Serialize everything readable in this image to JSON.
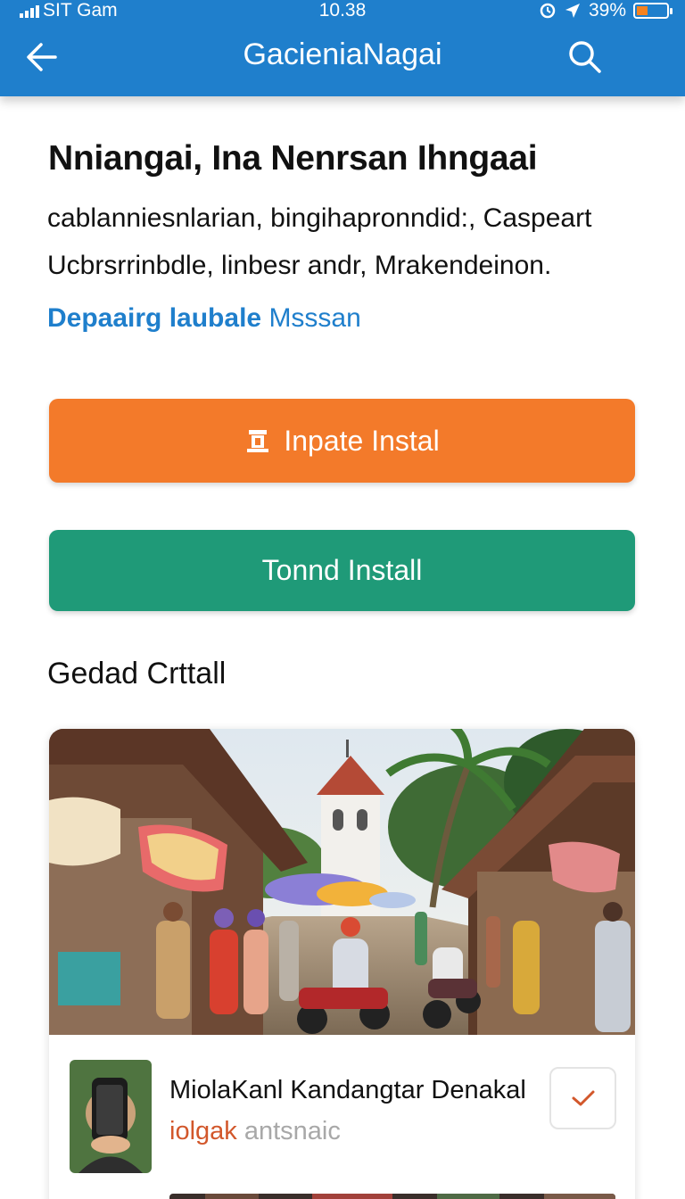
{
  "status_bar": {
    "carrier": "SIT Gam",
    "time": "10.38",
    "battery_percent": "39%",
    "battery_level": 0.39
  },
  "header": {
    "title": "GacieniaNagai",
    "back_icon": "back-arrow-icon",
    "search_icon": "search-icon"
  },
  "content": {
    "headline": "Nniangai, Ina Nenrsan Ihngaai",
    "description_line1": "cablanniesnlarian, bingihapronndid:, Caspeart",
    "description_line2": "Ucbrsrrinbdle, linbesr andr, Mrakendeinon.",
    "link_strong": "Depaairg laubale",
    "link_rest": "Msssan",
    "primary_button": "Inpate Instal",
    "secondary_button": "Tonnd Install",
    "section_title": "Gedad Crttall"
  },
  "card": {
    "item_title": "MiolaKanl Kandangtar Denakal",
    "item_sub_accent": "iolgak",
    "item_sub_muted": "antsnaic"
  },
  "colors": {
    "appbar": "#1f7fcc",
    "primary": "#f37a2a",
    "secondary": "#1f9a78",
    "link": "#1f7fcc",
    "accent": "#d2572b"
  }
}
